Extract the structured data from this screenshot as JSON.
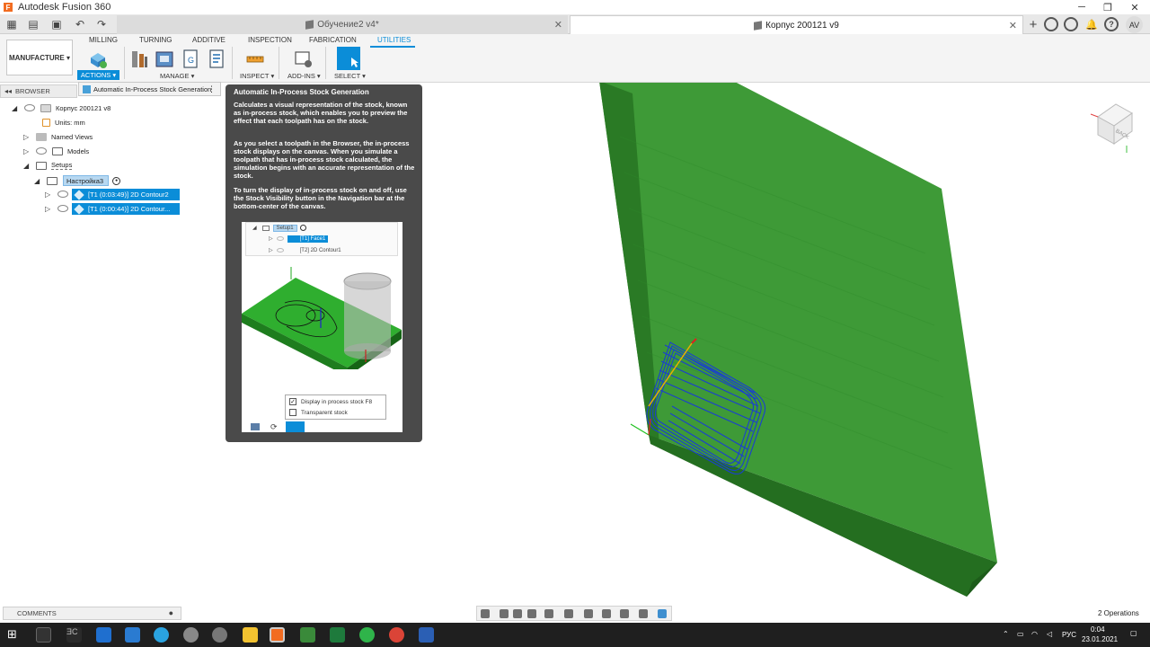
{
  "window": {
    "app_title": "Autodesk Fusion 360",
    "app_logo": "F"
  },
  "tabs": {
    "inactive_tab": "Обучение2 v4*",
    "active_tab": "Корпус 200121 v9",
    "new_tab": "+",
    "user_initials": "AV"
  },
  "ribbon": {
    "workspace": "MANUFACTURE ▾",
    "tabs": [
      "MILLING",
      "TURNING",
      "ADDITIVE",
      "INSPECTION",
      "FABRICATION",
      "UTILITIES"
    ],
    "active_tab": "UTILITIES",
    "groups": {
      "actions": "ACTIONS ▾",
      "manage": "MANAGE ▾",
      "inspect": "INSPECT ▾",
      "add_ins": "ADD-INS ▾",
      "select": "SELECT ▾"
    },
    "dropdown_item": "Automatic In-Process Stock Generation"
  },
  "browser": {
    "header": "BROWSER",
    "root": "Корпус 200121 v8",
    "units": "Units: mm",
    "named_views": "Named Views",
    "models": "Models",
    "setups": "Setups",
    "setup_name": "Настройка3",
    "operations": [
      "[T1 (0:03:49)] 2D Contour2",
      "[T1 (0:00:44)] 2D Contour..."
    ]
  },
  "tooltip": {
    "title": "Automatic In-Process Stock Generation",
    "paragraph1": "Calculates a visual representation of the stock, known as in-process stock, which enables you to preview the effect that each toolpath has on the stock.",
    "paragraph2": "As you select a toolpath in the Browser, the in-process stock displays on the canvas. When you simulate a toolpath that has in-process stock calculated, the simulation begins with an accurate representation of the stock.",
    "paragraph3": "To turn the display of in-process stock on and off, use the Stock Visibility button in the Navigation bar at the bottom-center of the canvas.",
    "image": {
      "setup": "Setup1",
      "row1": "[T1] Face1",
      "row2": "[T2] 2D Contour1",
      "option1": "Display in process stock F8",
      "option1_checked": true,
      "option2": "Transparent stock",
      "option2_checked": false
    }
  },
  "viewcube": {
    "face": "BACK"
  },
  "bottom": {
    "comments": "COMMENTS",
    "operations_count": "2 Operations"
  },
  "taskbar": {
    "language": "РУС",
    "time": "0:04",
    "date": "23.01.2021"
  },
  "colors": {
    "accent": "#0b8dd8",
    "stock_green": "#2f8f2a",
    "tooltip_bg": "#4a4a4a"
  }
}
